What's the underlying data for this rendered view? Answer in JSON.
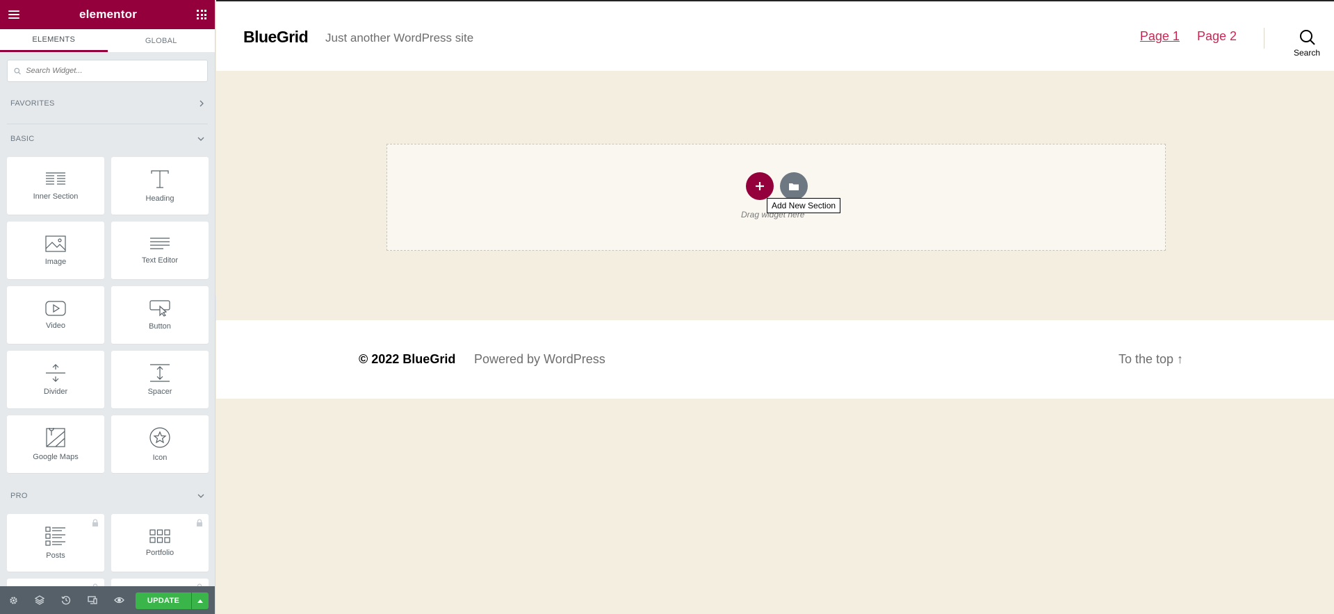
{
  "panel": {
    "brand": "elementor",
    "tabs": [
      {
        "label": "ELEMENTS",
        "active": true
      },
      {
        "label": "GLOBAL",
        "active": false
      }
    ],
    "search_placeholder": "Search Widget...",
    "categories": {
      "favorites": "FAVORITES",
      "basic": "BASIC",
      "pro": "PRO"
    },
    "basic_widgets": [
      {
        "label": "Inner Section",
        "icon": "inner-section-icon"
      },
      {
        "label": "Heading",
        "icon": "heading-icon"
      },
      {
        "label": "Image",
        "icon": "image-icon"
      },
      {
        "label": "Text Editor",
        "icon": "text-editor-icon"
      },
      {
        "label": "Video",
        "icon": "video-icon"
      },
      {
        "label": "Button",
        "icon": "button-icon"
      },
      {
        "label": "Divider",
        "icon": "divider-icon"
      },
      {
        "label": "Spacer",
        "icon": "spacer-icon"
      },
      {
        "label": "Google Maps",
        "icon": "google-maps-icon"
      },
      {
        "label": "Icon",
        "icon": "star-icon"
      }
    ],
    "pro_widgets": [
      {
        "label": "Posts",
        "icon": "posts-icon",
        "locked": true
      },
      {
        "label": "Portfolio",
        "icon": "portfolio-icon",
        "locked": true
      }
    ],
    "footer": {
      "update_label": "UPDATE"
    },
    "accent": "#93003c",
    "update_color": "#39b54a"
  },
  "site": {
    "title": "BlueGrid",
    "description": "Just another WordPress site",
    "nav": [
      {
        "label": "Page 1",
        "current": true
      },
      {
        "label": "Page 2",
        "current": false
      }
    ],
    "search_label": "Search",
    "link_color": "#cd2653",
    "background": "#f4eee0"
  },
  "editor": {
    "tooltip": "Add New Section",
    "drag_text": "Drag widget here"
  },
  "footer": {
    "copyright": "© 2022 BlueGrid",
    "powered": "Powered by WordPress",
    "to_top": "To the top ↑"
  }
}
